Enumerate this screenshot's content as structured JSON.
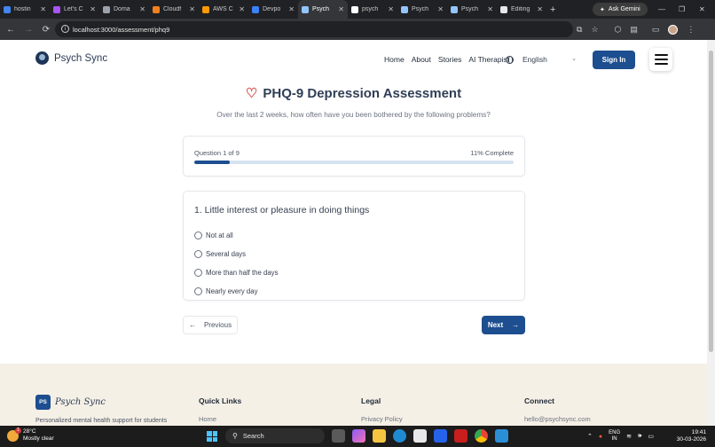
{
  "browser": {
    "tabs": [
      {
        "label": "hostin",
        "active": false,
        "icon": "google-icon",
        "color": "#4285f4"
      },
      {
        "label": "Let's C",
        "active": false,
        "icon": "vite-icon",
        "color": "#a855f7"
      },
      {
        "label": "Doma",
        "active": false,
        "icon": "domain-icon",
        "color": "#9ca3af"
      },
      {
        "label": "Cloudf",
        "active": false,
        "icon": "cloudflare-icon",
        "color": "#f48120"
      },
      {
        "label": "AWS C",
        "active": false,
        "icon": "aws-icon",
        "color": "#ff9900"
      },
      {
        "label": "Devpo",
        "active": false,
        "icon": "devpost-icon",
        "color": "#3b82f6"
      },
      {
        "label": "Psych",
        "active": true,
        "icon": "psych-icon",
        "color": "#93c5fd"
      },
      {
        "label": "psych",
        "active": false,
        "icon": "vercel-icon",
        "color": "#ffffff"
      },
      {
        "label": "Psych",
        "active": false,
        "icon": "psych-icon",
        "color": "#93c5fd"
      },
      {
        "label": "Psych",
        "active": false,
        "icon": "psych-icon",
        "color": "#93c5fd"
      },
      {
        "label": "Editing",
        "active": false,
        "icon": "github-icon",
        "color": "#e5e7eb"
      }
    ],
    "gemini_label": "Ask Gemini",
    "url": "localhost:3000/assessment/phq9"
  },
  "site": {
    "brand": "Psych Sync",
    "nav": [
      "Home",
      "About",
      "Stories",
      "AI Therapist"
    ],
    "language": "English",
    "signin_label": "Sign In"
  },
  "assessment": {
    "title": "PHQ-9 Depression Assessment",
    "subtitle": "Over the last 2 weeks, how often have you been bothered by the following problems?",
    "question_counter": "Question 1 of 9",
    "progress_text": "11% Complete",
    "progress": 0.11,
    "question": "1. Little interest or pleasure in doing things",
    "options": [
      "Not at all",
      "Several days",
      "More than half the days",
      "Nearly every day"
    ],
    "prev_label": "Previous",
    "next_label": "Next"
  },
  "footer": {
    "badge": "PS",
    "brand": "Psych Sync",
    "tagline": "Personalized mental health support for students",
    "columns": [
      {
        "heading": "Quick Links",
        "first_link": "Home"
      },
      {
        "heading": "Legal",
        "first_link": "Privacy Policy"
      },
      {
        "heading": "Connect",
        "first_link": "hello@psychsync.com"
      }
    ]
  },
  "taskbar": {
    "temperature": "28°C",
    "weather": "Mostly clear",
    "search_label": "Search",
    "lang_line1": "ENG",
    "lang_line2": "IN",
    "time": "19:41",
    "date": "30-03-2026"
  }
}
